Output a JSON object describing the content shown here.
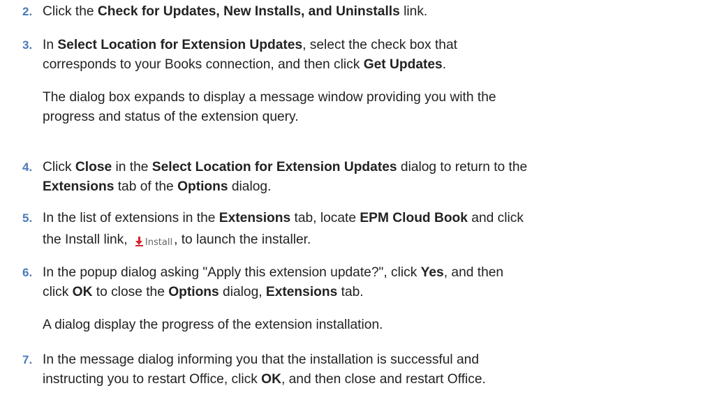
{
  "steps": [
    {
      "number": "2.",
      "line1": {
        "t1": "Click the ",
        "b1": "Check for Updates, New Installs, and Uninstalls",
        "t2": " link."
      }
    },
    {
      "number": "3.",
      "line1": {
        "t1": "In ",
        "b1": "Select Location for Extension Updates",
        "t2": ", select the check box that"
      },
      "line2": {
        "t1": "corresponds to your Books connection, and then click ",
        "b1": "Get Updates",
        "t2": "."
      },
      "note": {
        "line1": "The dialog box expands to display a message window providing you with the",
        "line2": "progress and status of the extension query."
      }
    },
    {
      "number": "4.",
      "line1": {
        "t1": "Click ",
        "b1": "Close",
        "t2": " in the ",
        "b2": "Select Location for Extension Updates",
        "t3": " dialog to return to the"
      },
      "line2": {
        "b1": "Extensions",
        "t1": " tab of the ",
        "b2": "Options",
        "t2": " dialog."
      }
    },
    {
      "number": "5.",
      "line1": {
        "t1": "In the list of extensions in the ",
        "b1": "Extensions",
        "t2": " tab, locate ",
        "b2": "EPM Cloud Book",
        "t3": " and click"
      },
      "line2": {
        "t1": "the Install link, ",
        "t2": ", to launch the installer."
      },
      "install_icon": {
        "icon": "download-arrow-icon",
        "color": "#d6232a",
        "label": "Install"
      }
    },
    {
      "number": "6.",
      "line1": {
        "t1": "In the popup dialog asking \"Apply this extension update?\", click ",
        "b1": "Yes",
        "t2": ", and then"
      },
      "line2": {
        "t1": "click ",
        "b1": "OK",
        "t2": " to close the ",
        "b2": "Options",
        "t3": " dialog, ",
        "b3": "Extensions",
        "t4": " tab."
      },
      "note": {
        "line1": "A dialog display the progress of the extension installation."
      }
    },
    {
      "number": "7.",
      "line1": {
        "t1": "In the message dialog informing you that the installation is successful and"
      },
      "line2": {
        "t1": "instructing you to restart Office, click ",
        "b1": "OK",
        "t2": ", and then close and restart Office."
      }
    }
  ],
  "colors": {
    "step_number": "#4a7ab8",
    "text": "#222222",
    "install_arrow": "#d6232a"
  }
}
